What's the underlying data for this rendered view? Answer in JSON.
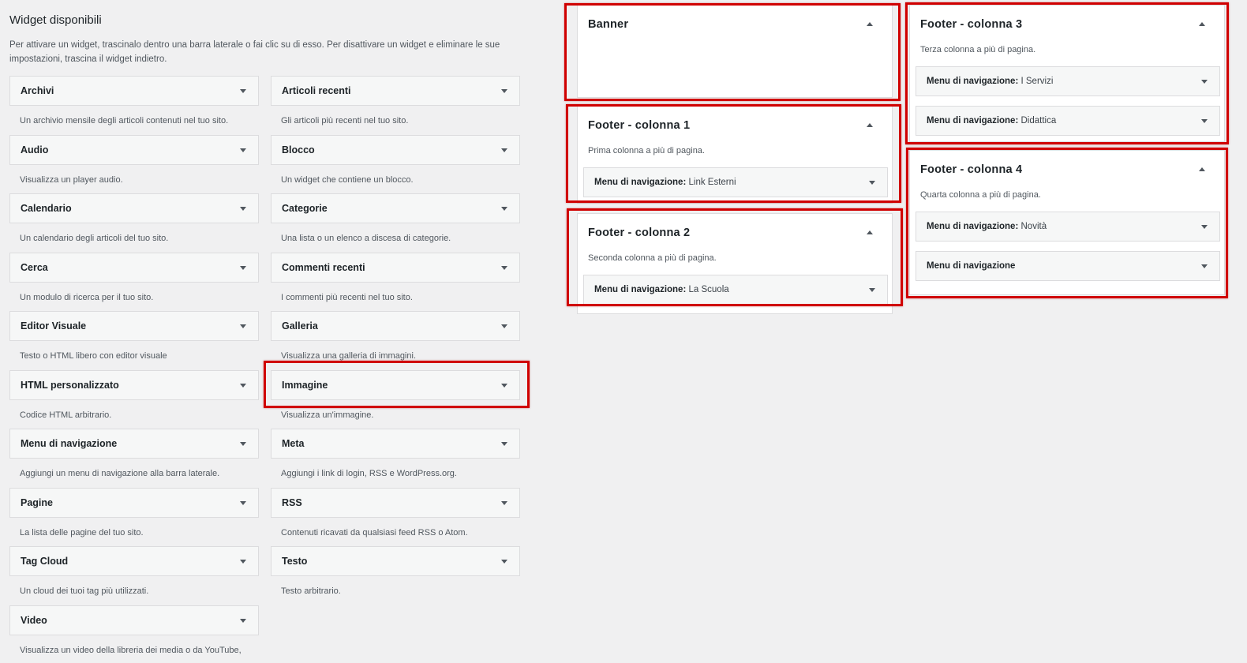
{
  "available": {
    "title": "Widget disponibili",
    "description": "Per attivare un widget, trascinalo dentro una barra laterale o fai clic su di esso. Per disattivare un widget e eliminare le sue impostazioni, trascina il widget indietro.",
    "widgets": [
      {
        "name": "Archivi",
        "desc": "Un archivio mensile degli articoli contenuti nel tuo sito."
      },
      {
        "name": "Articoli recenti",
        "desc": "Gli articoli più recenti nel tuo sito."
      },
      {
        "name": "Audio",
        "desc": "Visualizza un player audio."
      },
      {
        "name": "Blocco",
        "desc": "Un widget che contiene un blocco."
      },
      {
        "name": "Calendario",
        "desc": "Un calendario degli articoli del tuo sito."
      },
      {
        "name": "Categorie",
        "desc": "Una lista o un elenco a discesa di categorie."
      },
      {
        "name": "Cerca",
        "desc": "Un modulo di ricerca per il tuo sito."
      },
      {
        "name": "Commenti recenti",
        "desc": "I commenti più recenti nel tuo sito."
      },
      {
        "name": "Editor Visuale",
        "desc": "Testo o HTML libero con editor visuale"
      },
      {
        "name": "Galleria",
        "desc": "Visualizza una galleria di immagini."
      },
      {
        "name": "HTML personalizzato",
        "desc": "Codice HTML arbitrario."
      },
      {
        "name": "Immagine",
        "desc": "Visualizza un'immagine."
      },
      {
        "name": "Menu di navigazione",
        "desc": "Aggiungi un menu di navigazione alla barra laterale."
      },
      {
        "name": "Meta",
        "desc": "Aggiungi i link di login, RSS e WordPress.org."
      },
      {
        "name": "Pagine",
        "desc": "La lista delle pagine del tuo sito."
      },
      {
        "name": "RSS",
        "desc": "Contenuti ricavati da qualsiasi feed RSS o Atom."
      },
      {
        "name": "Tag Cloud",
        "desc": "Un cloud dei tuoi tag più utilizzati."
      },
      {
        "name": "Testo",
        "desc": "Testo arbitrario."
      },
      {
        "name": "Video",
        "desc": "Visualizza un video della libreria dei media o da YouTube,"
      }
    ]
  },
  "areas": {
    "banner": {
      "title": "Banner"
    },
    "footer1": {
      "title": "Footer - colonna 1",
      "desc": "Prima colonna a più di pagina.",
      "items": [
        {
          "label": "Menu di navigazione:",
          "value": "Link Esterni"
        }
      ]
    },
    "footer2": {
      "title": "Footer - colonna 2",
      "desc": "Seconda colonna a più di pagina.",
      "items": [
        {
          "label": "Menu di navigazione:",
          "value": "La Scuola"
        }
      ]
    },
    "footer3": {
      "title": "Footer - colonna 3",
      "desc": "Terza colonna a più di pagina.",
      "items": [
        {
          "label": "Menu di navigazione:",
          "value": "I Servizi"
        },
        {
          "label": "Menu di navigazione:",
          "value": "Didattica"
        }
      ]
    },
    "footer4": {
      "title": "Footer - colonna 4",
      "desc": "Quarta colonna a più di pagina.",
      "items": [
        {
          "label": "Menu di navigazione:",
          "value": "Novità"
        },
        {
          "label": "Menu di navigazione",
          "value": ""
        }
      ]
    }
  },
  "colors": {
    "highlight": "#d00000",
    "background": "#f0f0f1"
  },
  "icons": {
    "widget_toggle": "triangle-down-icon",
    "area_toggle": "triangle-up-icon"
  }
}
